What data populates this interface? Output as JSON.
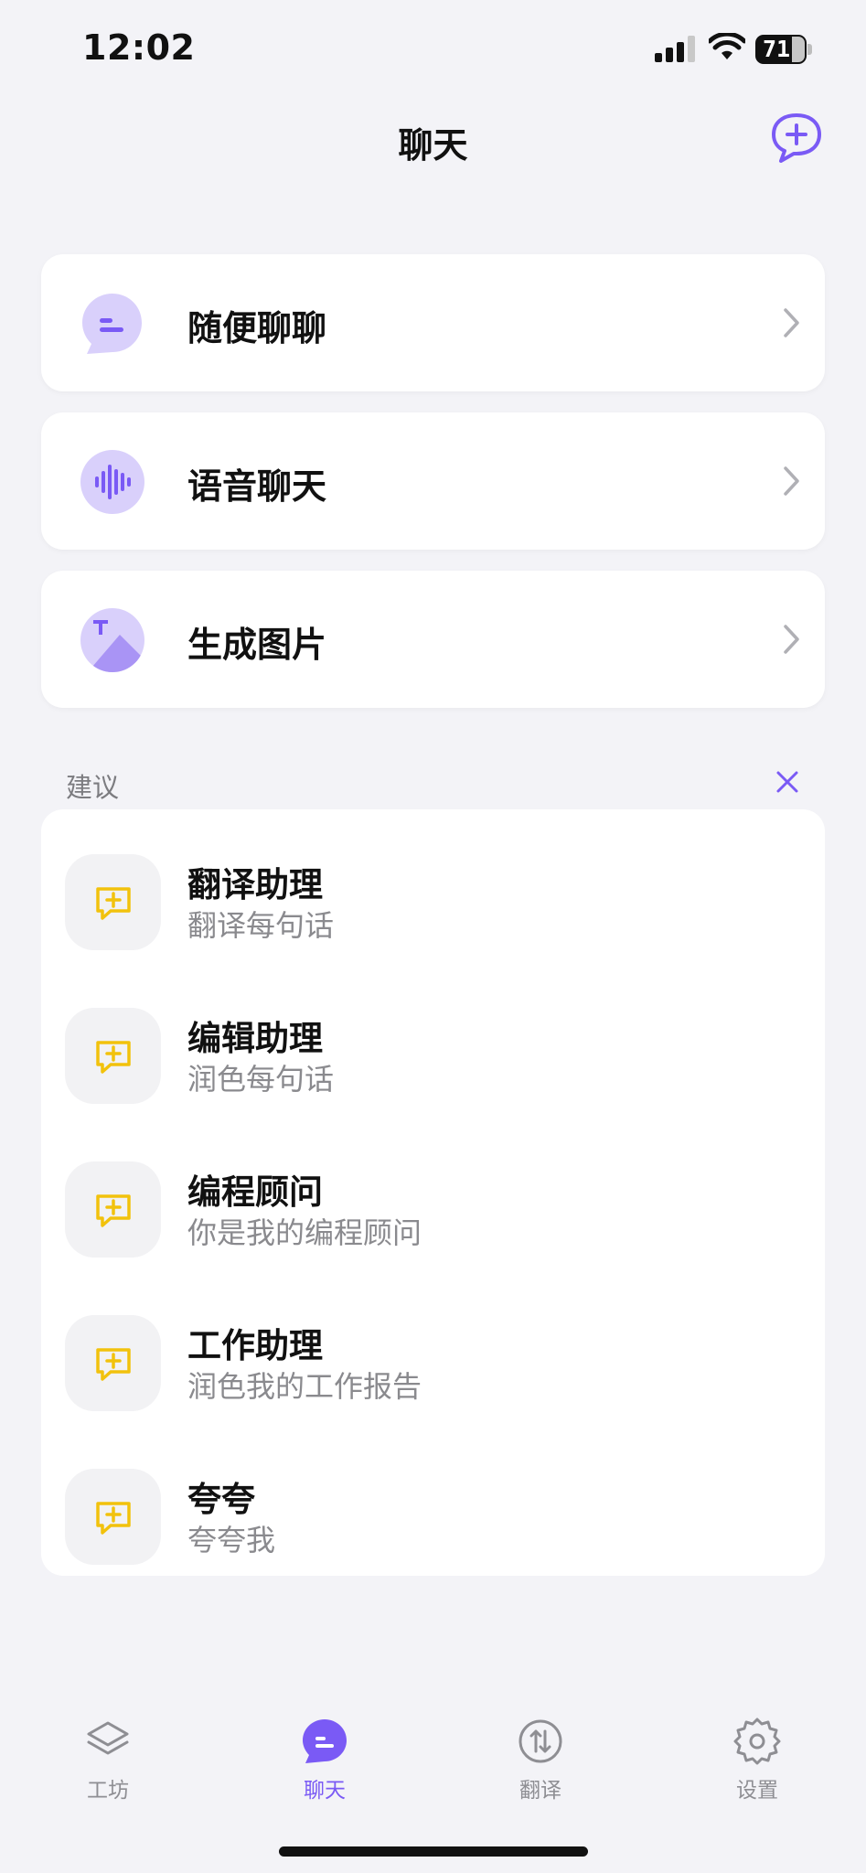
{
  "status_bar": {
    "time": "12:02",
    "battery": "71"
  },
  "header": {
    "title": "聊天"
  },
  "cards": [
    {
      "label": "随便聊聊",
      "icon": "chat-bubble-icon"
    },
    {
      "label": "语音聊天",
      "icon": "voice-wave-icon"
    },
    {
      "label": "生成图片",
      "icon": "image-generate-icon"
    }
  ],
  "suggestions": {
    "label": "建议",
    "items": [
      {
        "title": "翻译助理",
        "subtitle": "翻译每句话"
      },
      {
        "title": "编辑助理",
        "subtitle": "润色每句话"
      },
      {
        "title": "编程顾问",
        "subtitle": "你是我的编程顾问"
      },
      {
        "title": "工作助理",
        "subtitle": "润色我的工作报告"
      },
      {
        "title": "夸夸",
        "subtitle": "夸夸我"
      }
    ]
  },
  "tabs": [
    {
      "label": "工坊",
      "icon": "layers-icon",
      "active": false
    },
    {
      "label": "聊天",
      "icon": "chat-icon",
      "active": true
    },
    {
      "label": "翻译",
      "icon": "translate-arrows-icon",
      "active": false
    },
    {
      "label": "设置",
      "icon": "gear-icon",
      "active": false
    }
  ],
  "colors": {
    "accent": "#7a5af5",
    "accent_light": "#d9d0fb",
    "suggestion_icon": "#f2c20c",
    "background": "#f3f3f7"
  }
}
